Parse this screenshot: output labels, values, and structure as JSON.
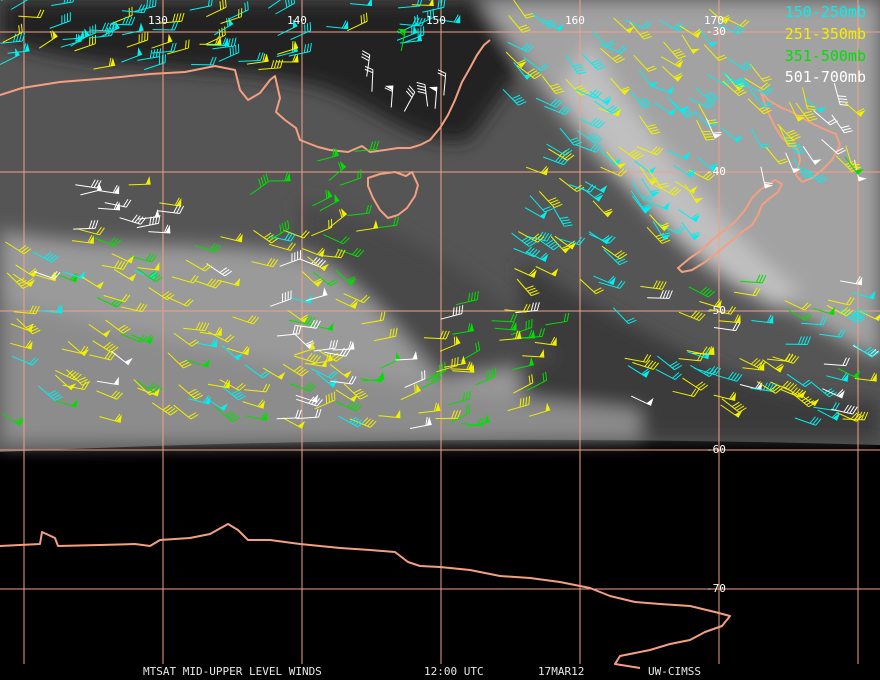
{
  "colors": {
    "grid": "#f0a088",
    "coast": "#f4a080",
    "cloud": "#8c8c8c"
  },
  "legend": [
    {
      "label": "150-250mb",
      "color": "#00f0f0"
    },
    {
      "label": "251-350mb",
      "color": "#f0f000"
    },
    {
      "label": "351-500mb",
      "color": "#00e000"
    },
    {
      "label": "501-700mb",
      "color": "#ffffff"
    }
  ],
  "grid": {
    "longitudes": [
      "130",
      "140",
      "150",
      "160",
      "170"
    ],
    "latitudes": [
      "-30",
      "-40",
      "-50",
      "-60",
      "-70"
    ]
  },
  "footer": {
    "product": "MTSAT MID-UPPER LEVEL WINDS",
    "time": "12:00 UTC",
    "date": "17MAR12",
    "source": "UW-CIMSS"
  }
}
